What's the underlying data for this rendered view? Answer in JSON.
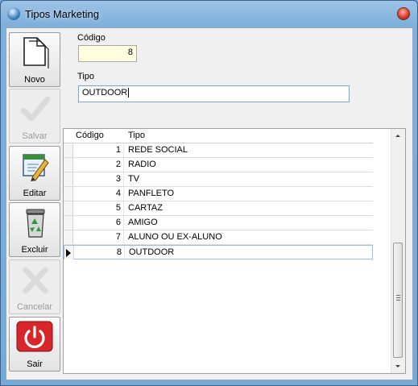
{
  "window": {
    "title": "Tipos Marketing"
  },
  "toolbar": {
    "novo": "Novo",
    "salvar": "Salvar",
    "editar": "Editar",
    "excluir": "Excluir",
    "cancelar": "Cancelar",
    "sair": "Sair"
  },
  "form": {
    "codigo_label": "Código",
    "codigo_value": "8",
    "tipo_label": "Tipo",
    "tipo_value": "OUTDOOR"
  },
  "grid": {
    "columns": [
      "Código",
      "Tipo"
    ],
    "rows": [
      {
        "codigo": "1",
        "tipo": "REDE SOCIAL"
      },
      {
        "codigo": "2",
        "tipo": "RADIO"
      },
      {
        "codigo": "3",
        "tipo": "TV"
      },
      {
        "codigo": "4",
        "tipo": "PANFLETO"
      },
      {
        "codigo": "5",
        "tipo": "CARTAZ"
      },
      {
        "codigo": "6",
        "tipo": "AMIGO"
      },
      {
        "codigo": "7",
        "tipo": "ALUNO OU EX-ALUNO"
      },
      {
        "codigo": "8",
        "tipo": "OUTDOOR"
      }
    ],
    "selected_index": 7
  }
}
